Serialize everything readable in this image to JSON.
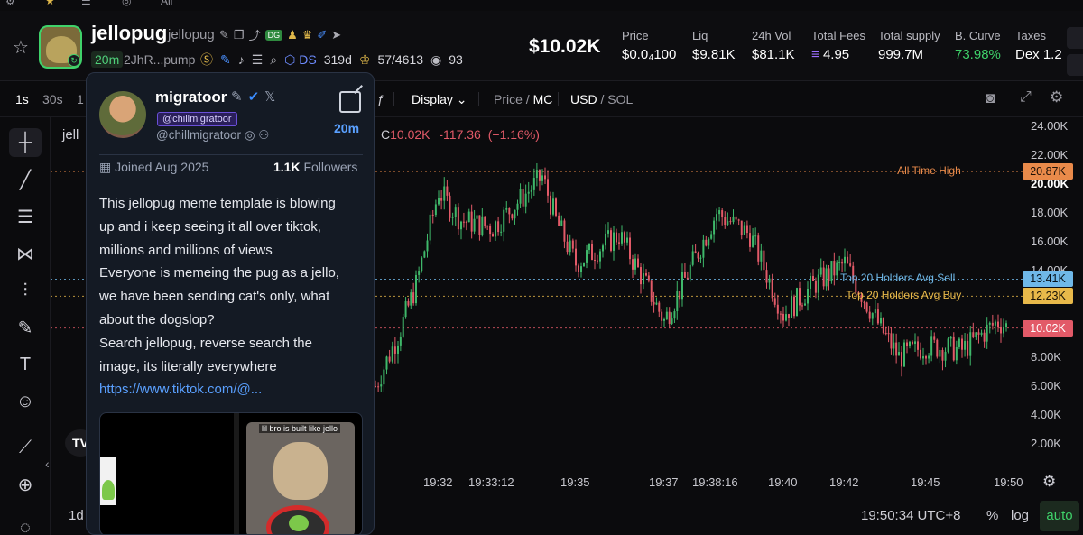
{
  "top": {
    "partial_label": "All"
  },
  "token": {
    "name": "jellopug",
    "ticker": "jellopug",
    "age": "20m",
    "address": "2JhR...pump",
    "tag": "DS",
    "days": "319d",
    "holders_ratio": "57/4613",
    "views": "93",
    "badge_dg": "DG",
    "market_cap": "$10.02K"
  },
  "stats": [
    {
      "label": "Price",
      "value": "$0.0₄100",
      "green": false
    },
    {
      "label": "Liq",
      "value": "$9.81K",
      "green": false
    },
    {
      "label": "24h Vol",
      "value": "$81.1K",
      "green": false
    },
    {
      "label": "Total Fees",
      "value": "4.95",
      "green": false
    },
    {
      "label": "Total supply",
      "value": "999.7M",
      "green": false
    },
    {
      "label": "B. Curve",
      "value": "73.98%",
      "green": true
    },
    {
      "label": "Taxes",
      "value": "Dex 1.2",
      "green": false
    }
  ],
  "toolbar": {
    "interval_1s": "1s",
    "interval_30s": "30s",
    "interval_1": "1",
    "display": "Display",
    "price": "Price",
    "mc": "MC",
    "usd": "USD",
    "sol": "SOL",
    "slash": "/"
  },
  "chart_data": {
    "type": "candlestick",
    "symbol_partial": "jell",
    "ohlc_label": "C",
    "close": "10.02K",
    "change": "-117.36",
    "change_pct": "(−1.16%)",
    "y_ticks": [
      "24.00K",
      "22.00K",
      "20.00K",
      "18.00K",
      "16.00K",
      "14.00K",
      "10.00K",
      "8.00K",
      "6.00K",
      "4.00K",
      "2.00K"
    ],
    "y_range": [
      0,
      25000
    ],
    "x_ticks": [
      "19:32",
      "19:33:12",
      "19:35",
      "19:37",
      "19:38:16",
      "19:40",
      "19:42",
      "19:45",
      "19:50"
    ],
    "levels": [
      {
        "name": "All Time High",
        "value": 20870,
        "tag": "20.87K",
        "color": "#e98a4a",
        "text_color": "#1a0f06"
      },
      {
        "name": "Top 20 Holders Avg Sell",
        "value": 13410,
        "tag": "13.41K",
        "color": "#6fb8e8",
        "text_color": "#06121a"
      },
      {
        "name": "Top 20 Holders Avg Buy",
        "value": 12230,
        "tag": "12.23K",
        "color": "#e8b94a",
        "text_color": "#1a1406"
      },
      {
        "name": "",
        "value": 10020,
        "tag": "10.02K",
        "color": "#e25a68",
        "text_color": "#ffffff"
      }
    ],
    "series": [
      {
        "x": "19:30",
        "y": 6000
      },
      {
        "x": "19:31",
        "y": 9500
      },
      {
        "x": "19:31:30",
        "y": 13000
      },
      {
        "x": "19:32",
        "y": 19500
      },
      {
        "x": "19:32:30",
        "y": 17500
      },
      {
        "x": "19:33:12",
        "y": 17000
      },
      {
        "x": "19:34",
        "y": 20500
      },
      {
        "x": "19:34:30",
        "y": 17500
      },
      {
        "x": "19:35",
        "y": 14500
      },
      {
        "x": "19:36",
        "y": 16500
      },
      {
        "x": "19:36:30",
        "y": 13000
      },
      {
        "x": "19:37",
        "y": 10500
      },
      {
        "x": "19:37:30",
        "y": 13000
      },
      {
        "x": "19:38:16",
        "y": 18000
      },
      {
        "x": "19:39",
        "y": 16500
      },
      {
        "x": "19:40",
        "y": 11000
      },
      {
        "x": "19:41",
        "y": 13000
      },
      {
        "x": "19:42",
        "y": 14500
      },
      {
        "x": "19:43",
        "y": 10000
      },
      {
        "x": "19:44",
        "y": 8000
      },
      {
        "x": "19:45",
        "y": 8800
      },
      {
        "x": "19:47",
        "y": 8500
      },
      {
        "x": "19:49",
        "y": 10500
      },
      {
        "x": "19:50",
        "y": 10020
      }
    ]
  },
  "bottom": {
    "interval": "1d",
    "time": "19:50:34 UTC+8",
    "percent": "%",
    "log": "log",
    "auto": "auto"
  },
  "card": {
    "username": "migratoor",
    "handle_pill": "@chillmigratoor",
    "handle": "@chillmigratoor",
    "age": "20m",
    "joined": "Joined Aug 2025",
    "followers_count": "1.1K",
    "followers_label": "Followers",
    "tweet_lines": [
      "This jellopug meme template is blowing",
      "up and i keep seeing it all over tiktok,",
      "millions and millions of views",
      "Everyone is memeing the pug as a jello,",
      "we have been sending cat's only, what",
      "about the dogslop?",
      "Search jellopug, reverse search the",
      "image, its literally everywhere"
    ],
    "link": "https://www.tiktok.com/@...",
    "media_caption": "lil bro is built like jello"
  },
  "colors": {
    "up": "#3fb86a",
    "down": "#e25a68",
    "accent_green": "#3fd26a",
    "link": "#5aa0ff"
  }
}
